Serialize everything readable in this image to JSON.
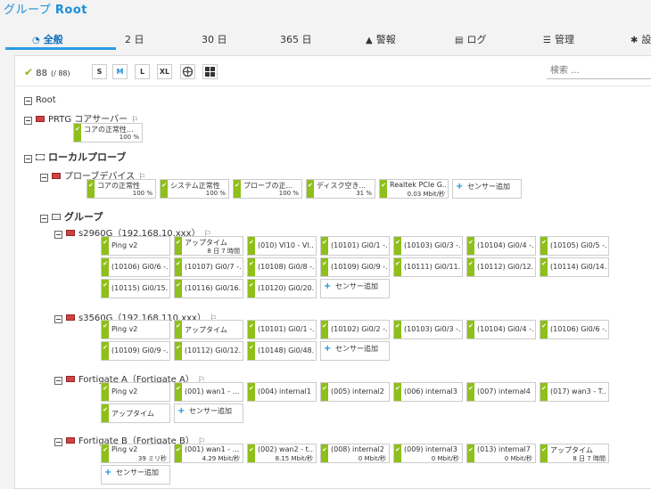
{
  "page": {
    "title_prefix": "グループ",
    "title_name": "Root"
  },
  "tabs": [
    {
      "label": "全般",
      "icon": "gauge-icon"
    },
    {
      "label": "2 日"
    },
    {
      "label": "30 日"
    },
    {
      "label": "365 日"
    },
    {
      "label": "警報",
      "icon": "warning-icon"
    },
    {
      "label": "ログ",
      "icon": "log-icon"
    },
    {
      "label": "管理",
      "icon": "sliders-icon"
    },
    {
      "label": "設",
      "icon": "gear-icon"
    }
  ],
  "toolbar": {
    "ok_count": "88",
    "total": "(/ 88)",
    "sizes": [
      "S",
      "M",
      "L",
      "XL"
    ],
    "search_placeholder": "検索 ..."
  },
  "tree": {
    "root": "Root",
    "core_server": "PRTG コアサーバー",
    "local_probe": "ローカルプローブ",
    "probe_device": "プローブデバイス",
    "group": "グループ",
    "s2960": "s2960G（192.168.10.xxx）",
    "s3560": "s3560G（192.168.110.xxx）",
    "fga": "Fortigate A（Fortigate A）",
    "fgb": "Fortigate B（Fortigate B）"
  },
  "add_sensor": "センサー追加",
  "sensors": {
    "core": [
      {
        "name": "コアの正常性...",
        "value": "100 %"
      }
    ],
    "probe": [
      {
        "name": "コアの正常性",
        "value": "100 %"
      },
      {
        "name": "システム正常性",
        "value": "100 %"
      },
      {
        "name": "プローブの正...",
        "value": "100 %"
      },
      {
        "name": "ディスク空き...",
        "value": "31 %"
      },
      {
        "name": "Realtek PCIe G...",
        "value": "0.03 Mbit/秒"
      }
    ],
    "s2960": [
      {
        "name": "Ping v2",
        "value": ""
      },
      {
        "name": "アップタイム",
        "value": "8 日 7 時間"
      },
      {
        "name": "(010) Vl10 - Vl...",
        "value": ""
      },
      {
        "name": "(10101) Gi0/1 -...",
        "value": ""
      },
      {
        "name": "(10103) Gi0/3 -...",
        "value": ""
      },
      {
        "name": "(10104) Gi0/4 -...",
        "value": ""
      },
      {
        "name": "(10105) Gi0/5 -...",
        "value": ""
      },
      {
        "name": "(10106) Gi0/6 -...",
        "value": ""
      },
      {
        "name": "(10107) Gi0/7 -...",
        "value": ""
      },
      {
        "name": "(10108) Gi0/8 -...",
        "value": ""
      },
      {
        "name": "(10109) Gi0/9 -...",
        "value": ""
      },
      {
        "name": "(10111) Gi0/11...",
        "value": ""
      },
      {
        "name": "(10112) Gi0/12...",
        "value": ""
      },
      {
        "name": "(10114) Gi0/14...",
        "value": ""
      },
      {
        "name": "(10115) Gi0/15...",
        "value": ""
      },
      {
        "name": "(10116) Gi0/16...",
        "value": ""
      },
      {
        "name": "(10120) Gi0/20...",
        "value": ""
      }
    ],
    "s3560": [
      {
        "name": "Ping v2",
        "value": ""
      },
      {
        "name": "アップタイム",
        "value": ""
      },
      {
        "name": "(10101) Gi0/1 -...",
        "value": ""
      },
      {
        "name": "(10102) Gi0/2 -...",
        "value": ""
      },
      {
        "name": "(10103) Gi0/3 -...",
        "value": ""
      },
      {
        "name": "(10104) Gi0/4 -...",
        "value": ""
      },
      {
        "name": "(10106) Gi0/6 -...",
        "value": ""
      },
      {
        "name": "(10109) Gi0/9 -...",
        "value": ""
      },
      {
        "name": "(10112) Gi0/12...",
        "value": ""
      },
      {
        "name": "(10148) Gi0/48...",
        "value": ""
      }
    ],
    "fga": [
      {
        "name": "Ping v2",
        "value": ""
      },
      {
        "name": "(001) wan1 - ...",
        "value": ""
      },
      {
        "name": "(004) internal1 ...",
        "value": ""
      },
      {
        "name": "(005) internal2 ...",
        "value": ""
      },
      {
        "name": "(006) internal3 ...",
        "value": ""
      },
      {
        "name": "(007) internal4 ...",
        "value": ""
      },
      {
        "name": "(017) wan3 - T...",
        "value": ""
      },
      {
        "name": "アップタイム",
        "value": ""
      }
    ],
    "fgb": [
      {
        "name": "Ping v2",
        "value": "39 ミリ秒"
      },
      {
        "name": "(001) wan1 - ...",
        "value": "4.29 Mbit/秒"
      },
      {
        "name": "(002) wan2 - t...",
        "value": "8.15 Mbit/秒"
      },
      {
        "name": "(008) internal2 ...",
        "value": "0 Mbit/秒"
      },
      {
        "name": "(009) internal3 ...",
        "value": "0 Mbit/秒"
      },
      {
        "name": "(013) internal7 ...",
        "value": "0 Mbit/秒"
      },
      {
        "name": "アップタイム",
        "value": "8 日 7 時間"
      }
    ]
  }
}
